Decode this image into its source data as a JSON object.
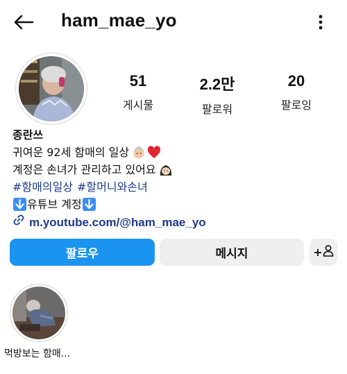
{
  "header": {
    "username": "ham_mae_yo"
  },
  "stats": [
    {
      "value": "51",
      "label": "게시물"
    },
    {
      "value": "2.2만",
      "label": "팔로워"
    },
    {
      "value": "20",
      "label": "팔로잉"
    }
  ],
  "bio": {
    "name": "종란쓰",
    "line1": "귀여운 92세 함매의 일상",
    "line2": "계정은 손녀가 관리하고 있어요",
    "hashtag1": "#함매의일상",
    "hashtag2": "#할머니와손녀",
    "youtube_label": "유튜브 계정",
    "link": "m.youtube.com/@ham_mae_yo"
  },
  "actions": {
    "follow": "팔로우",
    "message": "메시지",
    "add_user": "+"
  },
  "highlight": {
    "label": "먹방보는 함매..."
  },
  "colors": {
    "accent": "#1a94f0",
    "link": "#1e3a8a",
    "button_gray": "#efefef"
  }
}
